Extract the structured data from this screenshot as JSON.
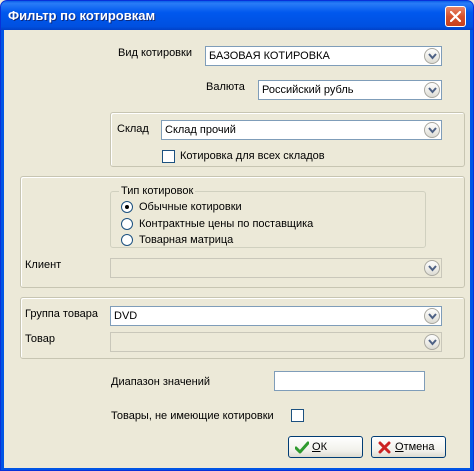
{
  "window": {
    "title": "Фильтр по котировкам"
  },
  "quote_type": {
    "label": "Вид котировки",
    "value": "БАЗОВАЯ КОТИРОВКА"
  },
  "currency": {
    "label": "Валюта",
    "value": "Российский рубль"
  },
  "warehouse": {
    "label": "Склад",
    "value": "Склад прочий",
    "all_warehouses_label": "Котировка для всех складов",
    "all_warehouses_checked": false
  },
  "quote_kind": {
    "group_label": "Тип котировок",
    "options": [
      {
        "label": "Обычные котировки",
        "selected": true
      },
      {
        "label": "Контрактные цены по поставщика",
        "selected": false
      },
      {
        "label": "Товарная матрица",
        "selected": false
      }
    ]
  },
  "client": {
    "label": "Клиент",
    "value": ""
  },
  "product_group": {
    "label": "Группа товара",
    "value": "DVD"
  },
  "product": {
    "label": "Товар",
    "value": ""
  },
  "value_range": {
    "label": "Диапазон значений",
    "value": ""
  },
  "no_quotes": {
    "label": "Товары, не имеющие котировки",
    "checked": false
  },
  "buttons": {
    "ok_label": "ОК",
    "cancel_label": "Отмена"
  },
  "colors": {
    "title_bar": "#0055e5",
    "dialog_bg": "#ece9d8",
    "ok_icon": "#2e9a2e",
    "cancel_icon": "#cc2222"
  }
}
